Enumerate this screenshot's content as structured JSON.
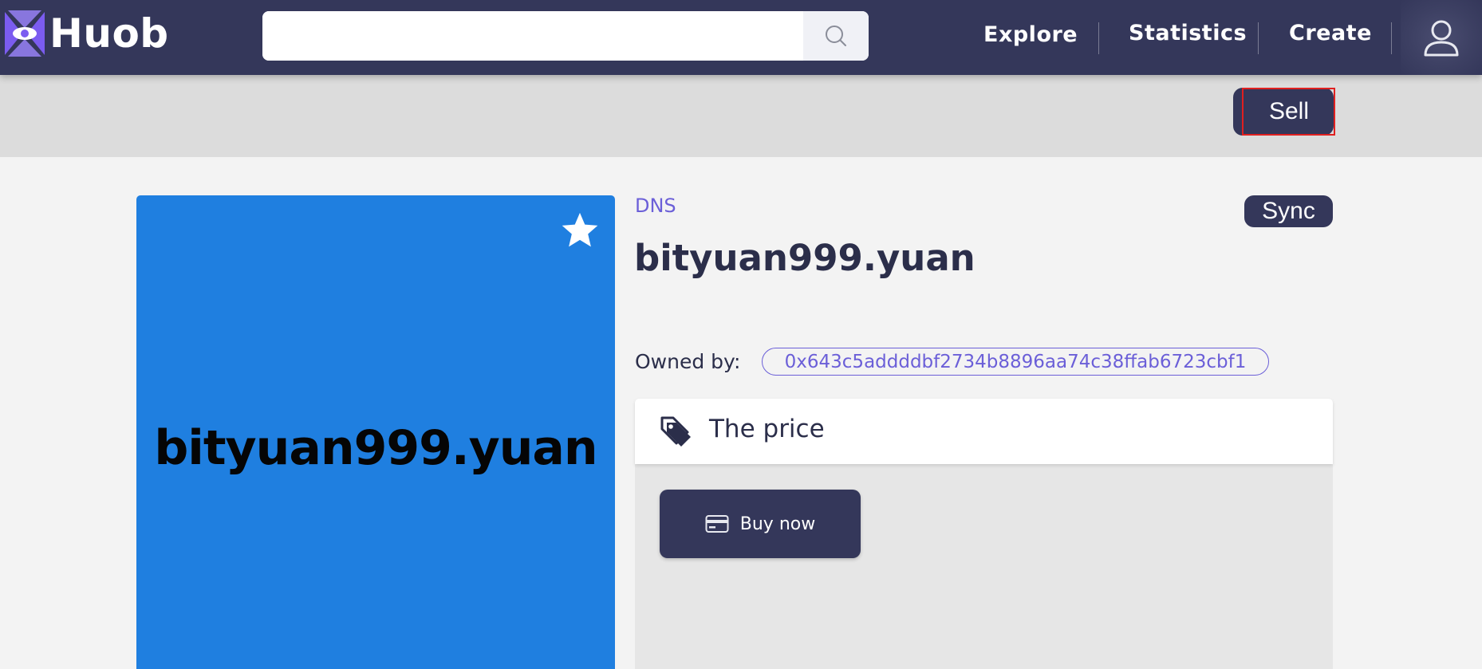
{
  "app": {
    "brand": "Huob"
  },
  "header": {
    "search": {
      "placeholder": "",
      "value": ""
    },
    "nav": {
      "explore": "Explore",
      "statistics": "Statistics",
      "create": "Create"
    }
  },
  "toolbar": {
    "sell_label": "Sell"
  },
  "nft": {
    "image_text": "bityuan999.yuan",
    "category": "DNS",
    "sync_label": "Sync",
    "title": "bityuan999.yuan",
    "owned_by_label": "Owned by:",
    "owner_address": "0x643c5addddbf2734b8896aa74c38ffab6723cbf1"
  },
  "price": {
    "header": "The price",
    "buy_label": "Buy now"
  },
  "colors": {
    "nav_bg": "#34375a",
    "accent": "#6b5fd8",
    "card_bg": "#1f7fe0",
    "highlight": "#e02020"
  }
}
